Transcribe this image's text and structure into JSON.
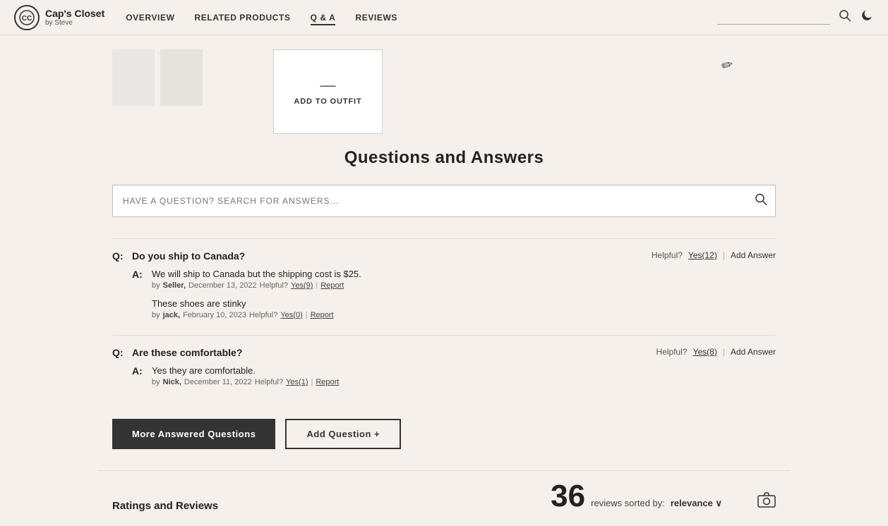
{
  "nav": {
    "logo": {
      "circle_text": "★",
      "title": "Cap's Closet",
      "subtitle": "by Steve"
    },
    "links": [
      {
        "label": "OVERVIEW",
        "active": false
      },
      {
        "label": "RELATED PRODUCTS",
        "active": false
      },
      {
        "label": "Q & A",
        "active": true
      },
      {
        "label": "REVIEWS",
        "active": false
      }
    ],
    "search_placeholder": ""
  },
  "outfit_box": {
    "plus_symbol": "—",
    "label": "ADD TO OUTFIT"
  },
  "qa": {
    "title": "Questions and Answers",
    "search_placeholder": "HAVE A QUESTION? SEARCH FOR ANSWERS...",
    "questions": [
      {
        "id": "q1",
        "q_label": "Q:",
        "question": "Do you ship to Canada?",
        "helpful_label": "Helpful?",
        "helpful_yes": "Yes(12)",
        "add_answer_label": "Add Answer",
        "answers": [
          {
            "a_label": "A:",
            "text": "We will ship to Canada but the shipping cost is $25.",
            "by": "by",
            "author": "Seller,",
            "date": "December 13, 2022",
            "helpful_label": "Helpful?",
            "helpful_yes": "Yes(9)",
            "report": "Report"
          },
          {
            "a_label": "",
            "text": "These shoes are stinky",
            "by": "by",
            "author": "jack,",
            "date": "February 10, 2023",
            "helpful_label": "Helpful?",
            "helpful_yes": "Yes(0)",
            "report": "Report"
          }
        ]
      },
      {
        "id": "q2",
        "q_label": "Q:",
        "question": "Are these comfortable?",
        "helpful_label": "Helpful?",
        "helpful_yes": "Yes(8)",
        "add_answer_label": "Add Answer",
        "answers": [
          {
            "a_label": "A:",
            "text": "Yes they are comfortable.",
            "by": "by",
            "author": "Nick,",
            "date": "December 11, 2022",
            "helpful_label": "Helpful?",
            "helpful_yes": "Yes(1)",
            "report": "Report"
          }
        ]
      }
    ],
    "more_button": "More Answered Questions",
    "add_button": "Add Question +"
  },
  "ratings": {
    "label": "Ratings and Reviews",
    "reviews_count": "36",
    "sorted_text": "reviews sorted by:",
    "relevance_text": "relevance ∨"
  }
}
